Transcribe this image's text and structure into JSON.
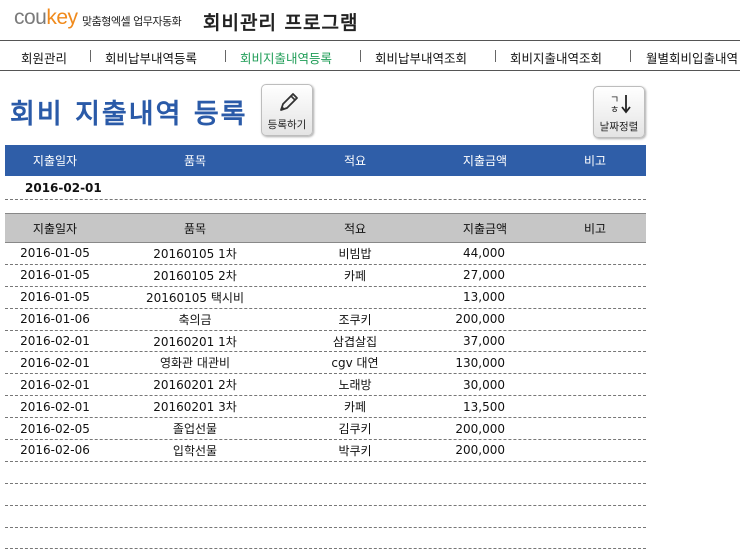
{
  "header": {
    "logo_a": "cou",
    "logo_b": "key",
    "slogan": "맞춤형엑셀 업무자동화",
    "app_title": "회비관리 프로그램"
  },
  "nav": [
    {
      "label": "회원관리"
    },
    {
      "label": "회비납부내역등록"
    },
    {
      "label": "회비지출내역등록"
    },
    {
      "label": "회비납부내역조회"
    },
    {
      "label": "회비지출내역조회"
    },
    {
      "label": "월별회비입출내역"
    }
  ],
  "page": {
    "title": "회비 지출내역 등록",
    "register_label": "등록하기",
    "sort_label": "날짜정렬",
    "register_icon": "pencil-icon",
    "sort_icon": "sort-date-icon"
  },
  "columns": [
    "지출일자",
    "품목",
    "적요",
    "지출금액",
    "비고"
  ],
  "entry": {
    "date": "2016-02-01"
  },
  "rows": [
    {
      "date": "2016-01-05",
      "item": "20160105 1차",
      "desc": "비빔밥",
      "amount": "44,000",
      "note": ""
    },
    {
      "date": "2016-01-05",
      "item": "20160105 2차",
      "desc": "카페",
      "amount": "27,000",
      "note": ""
    },
    {
      "date": "2016-01-05",
      "item": "20160105 택시비",
      "desc": "",
      "amount": "13,000",
      "note": ""
    },
    {
      "date": "2016-01-06",
      "item": "축의금",
      "desc": "조쿠키",
      "amount": "200,000",
      "note": ""
    },
    {
      "date": "2016-02-01",
      "item": "20160201 1차",
      "desc": "삼겹살집",
      "amount": "37,000",
      "note": ""
    },
    {
      "date": "2016-02-01",
      "item": "영화관 대관비",
      "desc": "cgv 대연",
      "amount": "130,000",
      "note": ""
    },
    {
      "date": "2016-02-01",
      "item": "20160201 2차",
      "desc": "노래방",
      "amount": "30,000",
      "note": ""
    },
    {
      "date": "2016-02-01",
      "item": "20160201 3차",
      "desc": "카페",
      "amount": "13,500",
      "note": ""
    },
    {
      "date": "2016-02-05",
      "item": "졸업선물",
      "desc": "김쿠키",
      "amount": "200,000",
      "note": ""
    },
    {
      "date": "2016-02-06",
      "item": "입학선물",
      "desc": "박쿠키",
      "amount": "200,000",
      "note": ""
    },
    {
      "date": "",
      "item": "",
      "desc": "",
      "amount": "",
      "note": ""
    },
    {
      "date": "",
      "item": "",
      "desc": "",
      "amount": "",
      "note": ""
    },
    {
      "date": "",
      "item": "",
      "desc": "",
      "amount": "",
      "note": ""
    },
    {
      "date": "",
      "item": "",
      "desc": "",
      "amount": "",
      "note": ""
    }
  ],
  "colors": {
    "accent": "#2f5ea8",
    "active_nav": "#1f9d57",
    "logo_orange": "#f08a1c"
  }
}
